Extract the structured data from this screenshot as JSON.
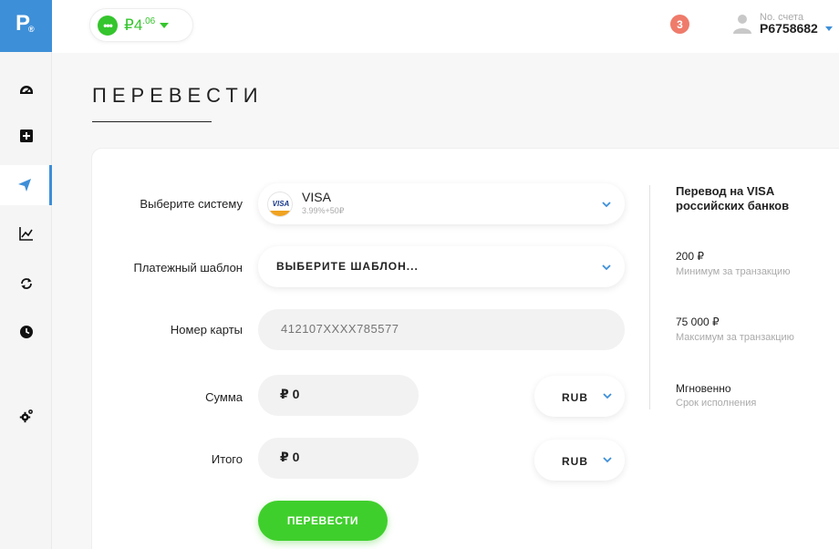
{
  "brand": {
    "logo_letter": "P",
    "logo_mark": "®",
    "accent": "#3d8fd8",
    "green": "#3fcf2c"
  },
  "sidebar": {
    "items": [
      {
        "icon": "dashboard-icon",
        "active": false
      },
      {
        "icon": "add-icon",
        "active": false
      },
      {
        "icon": "send-icon",
        "active": true
      },
      {
        "icon": "chart-icon",
        "active": false
      },
      {
        "icon": "exchange-icon",
        "active": false
      },
      {
        "icon": "history-icon",
        "active": false
      },
      {
        "icon": "settings-icon",
        "active": false
      }
    ]
  },
  "header": {
    "balance_currency": "₽",
    "balance_int": "4",
    "balance_dec": ".06",
    "balance_dot": "•••",
    "notifications_count": "3",
    "account_label": "No. счета",
    "account_number": "P6758682"
  },
  "page": {
    "title": "ПЕРЕВЕСТИ"
  },
  "form": {
    "system_label": "Выберите систему",
    "system_logo_text": "VISA",
    "system_name": "VISA",
    "system_fee": "3.99%+50₽",
    "template_label": "Платежный шаблон",
    "template_value": "ВЫБЕРИТЕ ШАБЛОН...",
    "card_label": "Номер карты",
    "card_placeholder": "412107XXXX785577",
    "amount_label": "Сумма",
    "amount_value": "₽ 0",
    "amount_currency": "RUB",
    "total_label": "Итого",
    "total_value": "₽ 0",
    "total_currency": "RUB",
    "submit_label": "ПЕРЕВЕСТИ"
  },
  "info": {
    "title": "Перевод на VISA российских банков",
    "min_value": "200 ₽",
    "min_label": "Минимум за транзакцию",
    "max_value": "75 000 ₽",
    "max_label": "Максимум за транзакцию",
    "speed_value": "Мгновенно",
    "speed_label": "Срок исполнения"
  }
}
